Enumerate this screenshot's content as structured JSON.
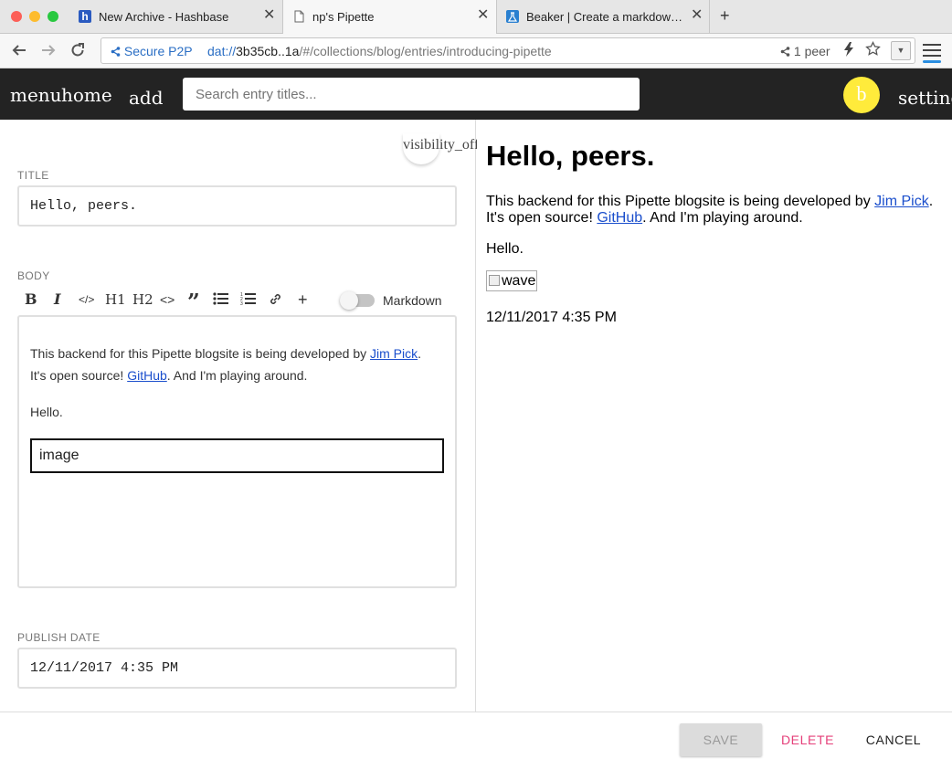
{
  "browser": {
    "tabs": [
      {
        "title": "New Archive - Hashbase",
        "favicon": "hashbase-logo-icon"
      },
      {
        "title": "np's Pipette",
        "favicon": "page-icon"
      },
      {
        "title": "Beaker | Create a markdown si...",
        "favicon": "beaker-icon"
      }
    ],
    "new_tab_label": "+",
    "close_glyph": "✕",
    "url": {
      "secure_label": "Secure P2P",
      "protocol": "dat://",
      "host": "3b35cb..1a",
      "path": "/#/collections/blog/entries/introducing-pipette"
    },
    "peers_label": "1 peer"
  },
  "app": {
    "nav": {
      "menu": "menu",
      "home": "home",
      "add": "add",
      "settings": "settings"
    },
    "search_placeholder": "Search entry titles...",
    "avatar_letter": "b",
    "avatar_color": "#ffeb3b"
  },
  "editor": {
    "visibility_label": "visibility_off",
    "title_label": "TITLE",
    "title_value": "Hello, peers.",
    "body_label": "BODY",
    "toolbar": {
      "bold": "B",
      "italic": "I",
      "code": "</>",
      "h1": "H1",
      "h2": "H2",
      "code_block": "<>",
      "quote": "”",
      "bullet_list": "•≡",
      "numbered_list": "1≡",
      "link": "⛓",
      "add": "+",
      "markdown_label": "Markdown"
    },
    "body": {
      "para1_pre": "This backend for this Pipette blogsite is being developed by ",
      "link1": "Jim Pick",
      "para1_mid": ". It's open source! ",
      "link2": "GitHub",
      "para1_post": ". And I'm playing around.",
      "para2": "Hello.",
      "image_placeholder": "image"
    },
    "publish_label": "PUBLISH DATE",
    "publish_value": "12/11/2017 4:35 PM"
  },
  "preview": {
    "title": "Hello, peers.",
    "para1_pre": "This backend for this Pipette blogsite is being developed by ",
    "link1": "Jim Pick",
    "para1_mid": ". It's open source! ",
    "link2": "GitHub",
    "para1_post": ". And I'm playing around.",
    "para2": "Hello.",
    "image_alt": "wave",
    "date": "12/11/2017 4:35 PM"
  },
  "footer": {
    "save": "SAVE",
    "delete": "DELETE",
    "cancel": "CANCEL"
  },
  "colors": {
    "link": "#1a4ecc",
    "delete": "#e5407a",
    "header_bg": "#232323"
  }
}
